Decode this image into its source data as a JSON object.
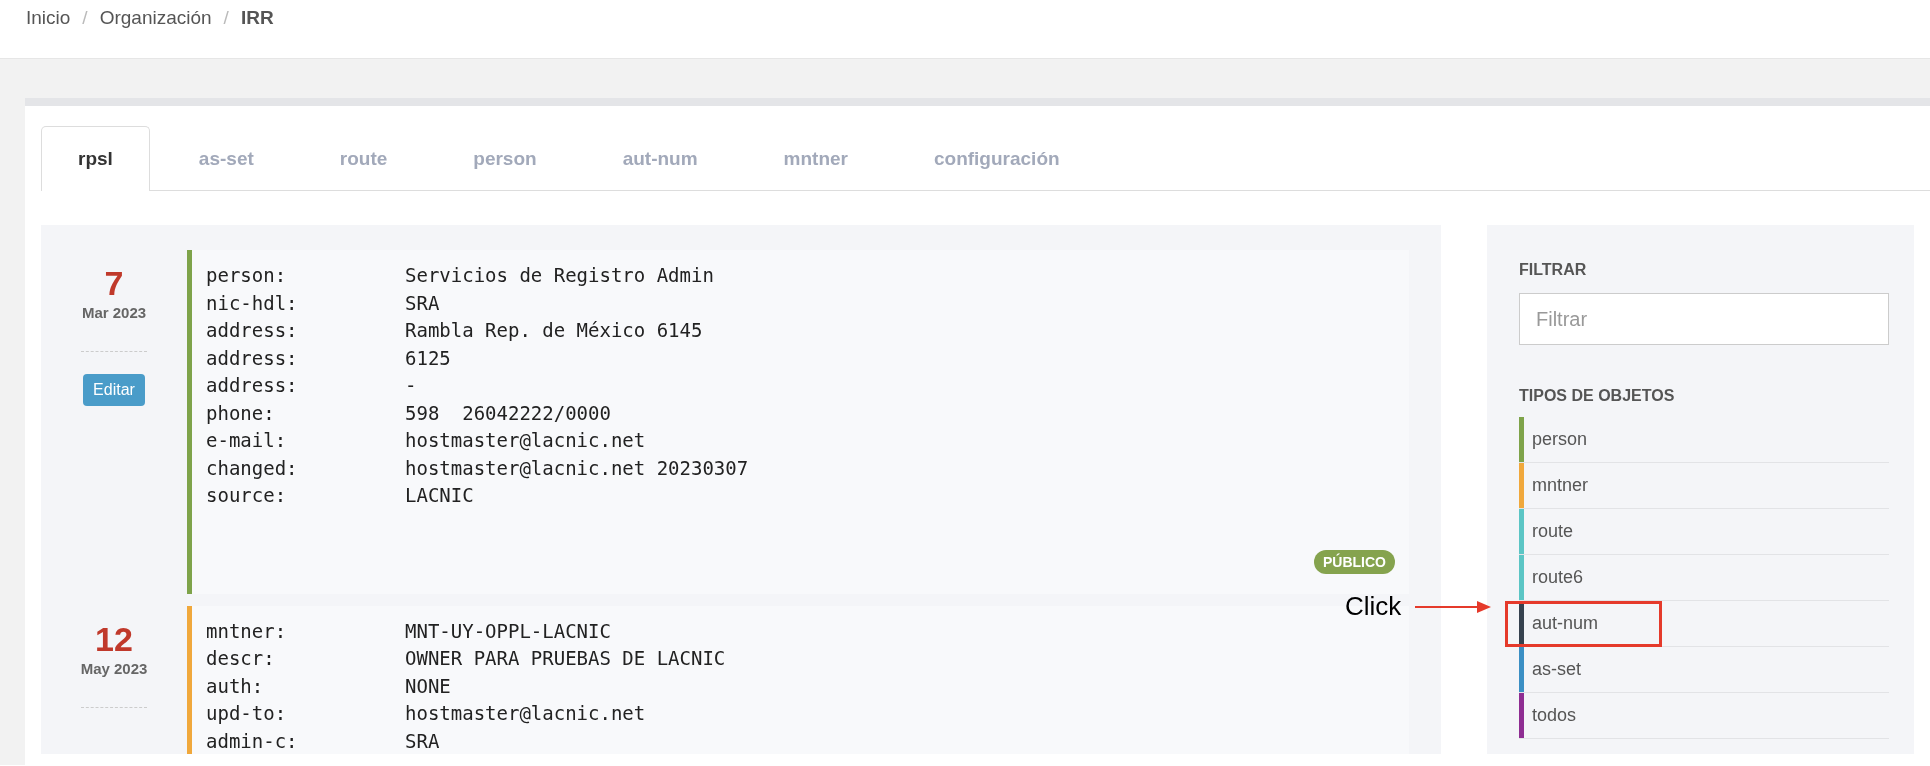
{
  "breadcrumb": [
    {
      "label": "Inicio",
      "current": false
    },
    {
      "label": "Organización",
      "current": false
    },
    {
      "label": "IRR",
      "current": true
    }
  ],
  "breadcrumb_separator": "/",
  "tabs": [
    {
      "label": "rpsl",
      "selected": true
    },
    {
      "label": "as-set",
      "selected": false
    },
    {
      "label": "route",
      "selected": false
    },
    {
      "label": "person",
      "selected": false
    },
    {
      "label": "aut-num",
      "selected": false
    },
    {
      "label": "mntner",
      "selected": false
    },
    {
      "label": "configuración",
      "selected": false
    }
  ],
  "records": [
    {
      "day": "7",
      "month_year": "Mar 2023",
      "edit_button": "Editar",
      "color": "#7ea34a",
      "badge": "PÚBLICO",
      "fields": [
        [
          "person:",
          "Servicios de Registro Admin"
        ],
        [
          "nic-hdl:",
          "SRA"
        ],
        [
          "address:",
          "Rambla Rep. de México 6145"
        ],
        [
          "address:",
          "6125"
        ],
        [
          "address:",
          "-"
        ],
        [
          "phone:",
          "598  26042222/0000"
        ],
        [
          "e-mail:",
          "hostmaster@lacnic.net"
        ],
        [
          "changed:",
          "hostmaster@lacnic.net 20230307"
        ],
        [
          "source:",
          "LACNIC"
        ]
      ]
    },
    {
      "day": "12",
      "month_year": "May 2023",
      "color": "#f0a83c",
      "fields": [
        [
          "mntner:",
          "MNT-UY-OPPL-LACNIC"
        ],
        [
          "descr:",
          "OWNER PARA PRUEBAS DE LACNIC"
        ],
        [
          "auth:",
          "NONE"
        ],
        [
          "upd-to:",
          "hostmaster@lacnic.net"
        ],
        [
          "admin-c:",
          "SRA"
        ]
      ]
    }
  ],
  "sidebar": {
    "filter_title": "FILTRAR",
    "filter_placeholder": "Filtrar",
    "types_title": "TIPOS DE OBJETOS",
    "types": [
      {
        "label": "person",
        "color": "#7ea34a",
        "highlighted": false
      },
      {
        "label": "mntner",
        "color": "#f0a83c",
        "highlighted": false
      },
      {
        "label": "route",
        "color": "#5bc5c5",
        "highlighted": false
      },
      {
        "label": "route6",
        "color": "#5bc5c5",
        "highlighted": false
      },
      {
        "label": "aut-num",
        "color": "#36424f",
        "highlighted": true
      },
      {
        "label": "as-set",
        "color": "#3b8fc4",
        "highlighted": false
      },
      {
        "label": "todos",
        "color": "#8e2d92",
        "highlighted": false
      }
    ]
  },
  "annotation": {
    "text": "Click"
  }
}
